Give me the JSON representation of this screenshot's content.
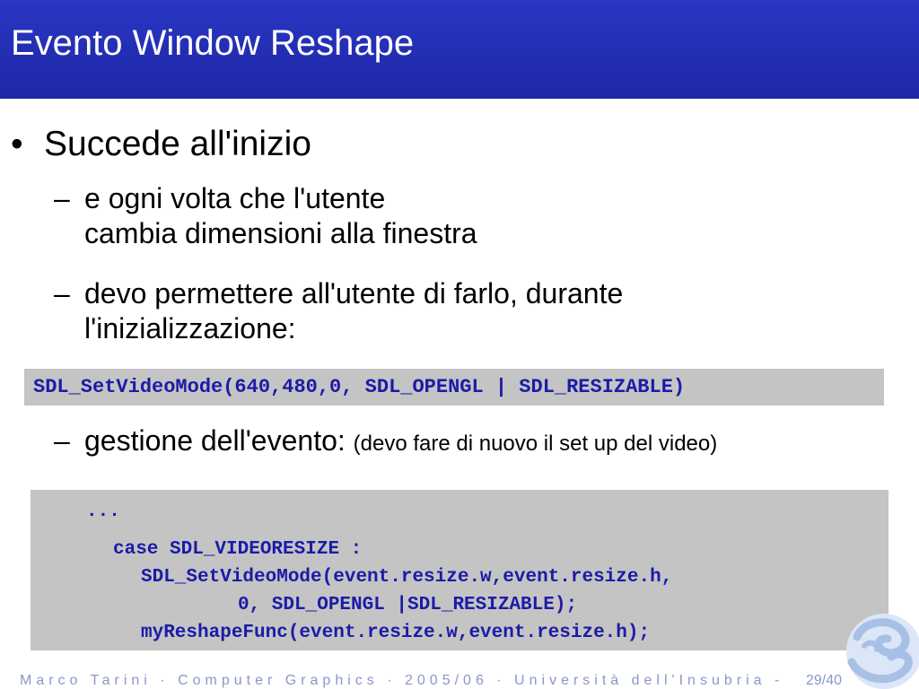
{
  "slide": {
    "title": "Evento Window Reshape"
  },
  "bullets": {
    "main": "Succede all'inizio",
    "main_mark": "•",
    "dash": "–",
    "sub1_line1": "e ogni volta che l'utente",
    "sub1_line2": "cambia dimensioni alla finestra",
    "sub2_line1": "devo permettere all'utente di farlo, durante",
    "sub2_line2": "l'inizializzazione:",
    "sub3_main": "gestione dell'evento:",
    "sub3_note": "(devo fare di nuovo il set up del video)"
  },
  "code": {
    "setvideomode": "SDL_SetVideoMode(640,480,0, SDL_OPENGL | SDL_RESIZABLE)",
    "handler_lines": [
      "...",
      "case SDL_VIDEORESIZE :",
      "SDL_SetVideoMode(event.resize.w,event.resize.h,",
      "0, SDL_OPENGL |SDL_RESIZABLE);",
      "myReshapeFunc(event.resize.w,event.resize.h);"
    ]
  },
  "footer": {
    "text": "Marco Tarini · Computer  Graphics · 2005/06 · Università dell'Insubria -",
    "page": "29/40"
  },
  "colors": {
    "title_bar": "#2a36c4",
    "code_background": "#c4c4c4",
    "code_text": "#1b1ba8",
    "footer_text": "#8a97c9"
  },
  "logo_icon": "insubria-logo-icon"
}
